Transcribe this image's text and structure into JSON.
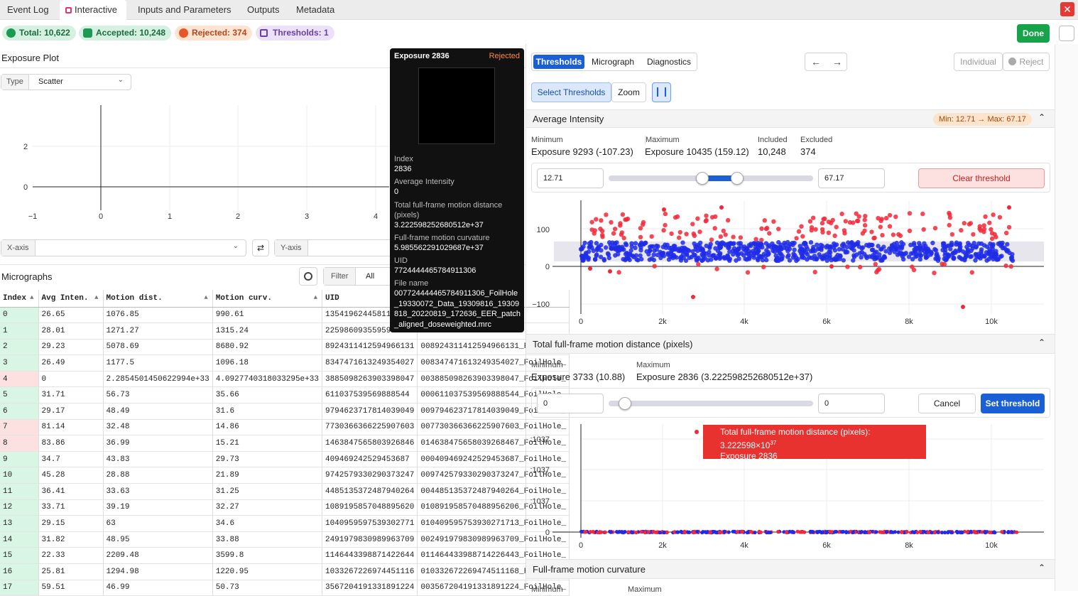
{
  "tabs": [
    "Event Log",
    "Interactive",
    "Inputs and Parameters",
    "Outputs",
    "Metadata"
  ],
  "pills": {
    "total": "Total: 10,622",
    "accepted": "Accepted: 10,248",
    "rejected": "Rejected: 374",
    "thresholds": "Thresholds: 1"
  },
  "done_label": "Done",
  "colors": {
    "accent": "#1a5fd6",
    "accepted": "#1a9a52",
    "rejected": "#e53935",
    "done": "#17a34a"
  },
  "exposure_plot": {
    "title": "Exposure Plot",
    "type_label": "Type",
    "type_value": "Scatter",
    "x_ticks": [
      "−1",
      "0",
      "1",
      "2",
      "3",
      "4"
    ],
    "y_ticks": [
      "2",
      "0"
    ],
    "xaxis_label": "X-axis",
    "yaxis_label": "Y-axis"
  },
  "tooltip": {
    "title": "Exposure 2836",
    "status": "Rejected",
    "fields": [
      {
        "label": "Index",
        "value": "2836"
      },
      {
        "label": "Average Intensity",
        "value": "0"
      },
      {
        "label": "Total full-frame motion distance (pixels)",
        "value": "3.222598252680512e+37"
      },
      {
        "label": "Full-frame motion curvature",
        "value": "5.985562291029687e+37"
      },
      {
        "label": "UID",
        "value": "7724444465784911306"
      },
      {
        "label": "File name",
        "value": "007724444465784911306_FoilHole_19330072_Data_19309816_19309818_20220819_172636_EER_patch_aligned_doseweighted.mrc"
      }
    ]
  },
  "micrographs": {
    "title": "Micrographs",
    "filter_label": "Filter",
    "filter_value": "All",
    "columns": [
      "Index",
      "Avg Inten.",
      "Motion dist.",
      "Motion curv.",
      "UID"
    ],
    "rows": [
      {
        "i": "0",
        "a": "26.65",
        "d": "1076.85",
        "c": "990.61",
        "u": "1354196244581179524",
        "f": "",
        "s": "acc"
      },
      {
        "i": "1",
        "a": "28.01",
        "d": "1271.27",
        "c": "1315.24",
        "u": "2259860935595903746",
        "f": "",
        "s": "acc"
      },
      {
        "i": "2",
        "a": "29.23",
        "d": "5078.69",
        "c": "8680.92",
        "u": "8924311412594966131",
        "f": "008924311412594966131_FoilHole_",
        "s": "acc"
      },
      {
        "i": "3",
        "a": "26.49",
        "d": "1177.5",
        "c": "1096.18",
        "u": "8347471613249354027",
        "f": "008347471613249354027_FoilHole_",
        "s": "acc"
      },
      {
        "i": "4",
        "a": "0",
        "d": "2.2854501450622994e+33",
        "c": "4.0927740318033295e+33",
        "u": "3885098263903398047",
        "f": "003885098263903398047_FoilHole_",
        "s": "rej"
      },
      {
        "i": "5",
        "a": "31.71",
        "d": "56.73",
        "c": "35.66",
        "u": "611037539569888544",
        "f": "000611037539569888544_FoilHole_",
        "s": "acc"
      },
      {
        "i": "6",
        "a": "29.17",
        "d": "48.49",
        "c": "31.6",
        "u": "9794623717814039049",
        "f": "009794623717814039049_FoilHole_",
        "s": "acc"
      },
      {
        "i": "7",
        "a": "81.14",
        "d": "32.48",
        "c": "14.86",
        "u": "7730366366225907603",
        "f": "007730366366225907603_FoilHole_",
        "s": "rej"
      },
      {
        "i": "8",
        "a": "83.86",
        "d": "36.99",
        "c": "15.21",
        "u": "1463847565803926846",
        "f": "014638475658039268467_FoilHole_",
        "s": "rej"
      },
      {
        "i": "9",
        "a": "34.7",
        "d": "43.83",
        "c": "29.73",
        "u": "409469242529453687",
        "f": "000409469242529453687_FoilHole_",
        "s": "acc"
      },
      {
        "i": "10",
        "a": "45.28",
        "d": "28.88",
        "c": "21.89",
        "u": "9742579330290373247",
        "f": "009742579330290373247_FoilHole_",
        "s": "acc"
      },
      {
        "i": "11",
        "a": "36.41",
        "d": "33.63",
        "c": "31.25",
        "u": "4485135372487940264",
        "f": "004485135372487940264_FoilHole_",
        "s": "acc"
      },
      {
        "i": "12",
        "a": "33.71",
        "d": "39.19",
        "c": "32.27",
        "u": "1089195857048895620",
        "f": "010891958570488956206_FoilHole_",
        "s": "acc"
      },
      {
        "i": "13",
        "a": "29.15",
        "d": "63",
        "c": "34.6",
        "u": "1040959597539302771",
        "f": "010409595753930271713_FoilHole_",
        "s": "acc"
      },
      {
        "i": "14",
        "a": "31.82",
        "d": "48.95",
        "c": "33.88",
        "u": "2491979830989963709",
        "f": "002491979830989963709_FoilHole_",
        "s": "acc"
      },
      {
        "i": "15",
        "a": "22.33",
        "d": "2209.48",
        "c": "3599.8",
        "u": "1146443398871422644",
        "f": "011464433988714226443_FoilHole_",
        "s": "acc"
      },
      {
        "i": "16",
        "a": "25.81",
        "d": "1294.98",
        "c": "1220.95",
        "u": "1033267226974451116",
        "f": "010332672269474511168_FoilHole_",
        "s": "acc"
      },
      {
        "i": "17",
        "a": "59.51",
        "d": "46.99",
        "c": "50.73",
        "u": "3567204191331891224",
        "f": "003567204191331891224_FoilHole_",
        "s": "acc"
      }
    ]
  },
  "right": {
    "view_tabs": [
      "Thresholds",
      "Micrograph",
      "Diagnostics"
    ],
    "individual_label": "Individual",
    "reject_label": "Reject",
    "select_thresholds_label": "Select Thresholds",
    "zoom_label": "Zoom",
    "avg": {
      "title": "Average Intensity",
      "range_badge": "Min: 12.71 → Max: 67.17",
      "min_label": "Minimum",
      "min_value": "Exposure 9293 (-107.23)",
      "max_label": "Maximum",
      "max_value": "Exposure 10435 (159.12)",
      "inc_label": "Included",
      "inc_value": "10,248",
      "exc_label": "Excluded",
      "exc_value": "374",
      "low": "12.71",
      "high": "67.17",
      "clear_label": "Clear threshold",
      "y_ticks": [
        "100",
        "0",
        "−100"
      ],
      "x_ticks": [
        "0",
        "2k",
        "4k",
        "6k",
        "8k",
        "10k"
      ]
    },
    "motion": {
      "title": "Total full-frame motion distance (pixels)",
      "min_label": "Minimum",
      "min_value": "Exposure 3733 (10.88)",
      "max_label": "Maximum",
      "max_value": "Exposure 2836 (3.222598252680512e+37)",
      "low": "0",
      "high": "0",
      "cancel_label": "Cancel",
      "set_label": "Set threshold",
      "y_ticks": [
        ":1037",
        ":1037",
        ":1037",
        "0"
      ],
      "x_ticks": [
        "0",
        "2k",
        "4k",
        "6k",
        "8k",
        "10k"
      ],
      "hover_line1": "Total full-frame motion distance (pixels): 3.222598×10",
      "hover_exp": "37",
      "hover_line2": "Exposure 2836"
    },
    "curv": {
      "title": "Full-frame motion curvature",
      "min_label": "Minimum",
      "max_label": "Maximum"
    }
  }
}
